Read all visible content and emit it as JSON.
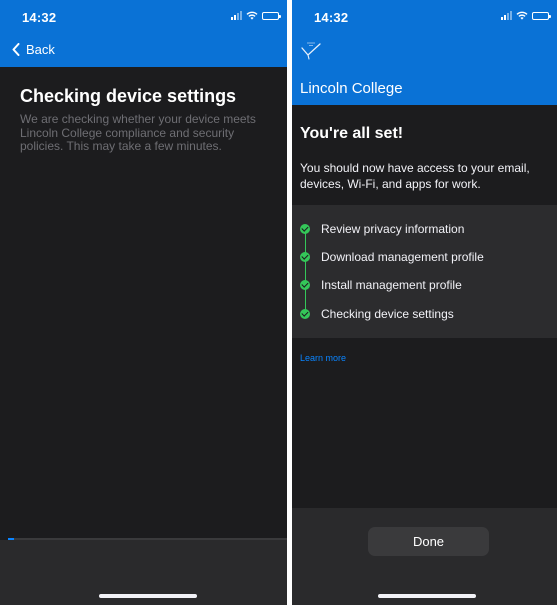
{
  "left_screen": {
    "status_bar": {
      "time": "14:32"
    },
    "nav": {
      "back_label": "Back"
    },
    "title": "Checking device settings",
    "description": "We are checking whether your device meets Lincoln College compliance and security policies. This may take a few minutes.",
    "progress": 0.02
  },
  "right_screen": {
    "status_bar": {
      "time": "14:32"
    },
    "header": {
      "org_name": "Lincoln College"
    },
    "success": {
      "title": "You're all set!",
      "description": "You should now have access to your email, devices, Wi-Fi, and apps for work."
    },
    "steps": [
      {
        "label": "Review privacy information",
        "status": "complete"
      },
      {
        "label": "Download management profile",
        "status": "complete"
      },
      {
        "label": "Install management profile",
        "status": "complete"
      },
      {
        "label": "Checking device settings",
        "status": "complete"
      }
    ],
    "learn_more": "Learn more",
    "done_label": "Done"
  },
  "colors": {
    "brand_blue": "#0a72d6",
    "success_green": "#34c759",
    "link_blue": "#0a84ff",
    "background_dark": "#1c1c1e"
  },
  "icons": [
    "chevron-left-icon",
    "signal-icon",
    "wifi-icon",
    "battery-icon",
    "college-logo-icon",
    "check-circle-icon"
  ]
}
